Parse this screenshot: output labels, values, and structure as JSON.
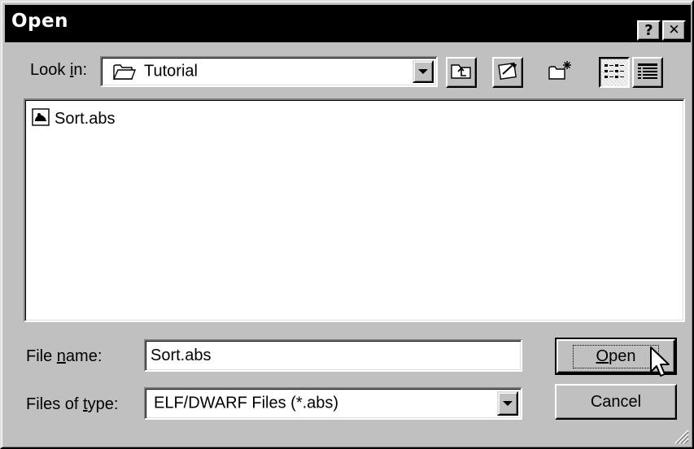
{
  "window": {
    "title": "Open",
    "help_button": "?",
    "close_button": "✕"
  },
  "look_in": {
    "label_pre": "Look ",
    "label_mnemonic": "i",
    "label_post": "n:",
    "value": "Tutorial",
    "icon": "folder-icon"
  },
  "toolbar": {
    "buttons": [
      "up-one-level",
      "desktop",
      "create-new-folder",
      "list-view",
      "details-view"
    ],
    "active": "list-view"
  },
  "files": [
    {
      "name": "Sort.abs",
      "icon": "file-icon"
    }
  ],
  "file_name": {
    "label_pre": "File ",
    "label_mnemonic": "n",
    "label_post": "ame:",
    "value": "Sort.abs"
  },
  "file_type": {
    "label_pre": "Files of ",
    "label_mnemonic": "t",
    "label_post": "ype:",
    "value": "ELF/DWARF Files (*.abs)"
  },
  "buttons": {
    "open_mnemonic": "O",
    "open_rest": "pen",
    "cancel": "Cancel"
  }
}
